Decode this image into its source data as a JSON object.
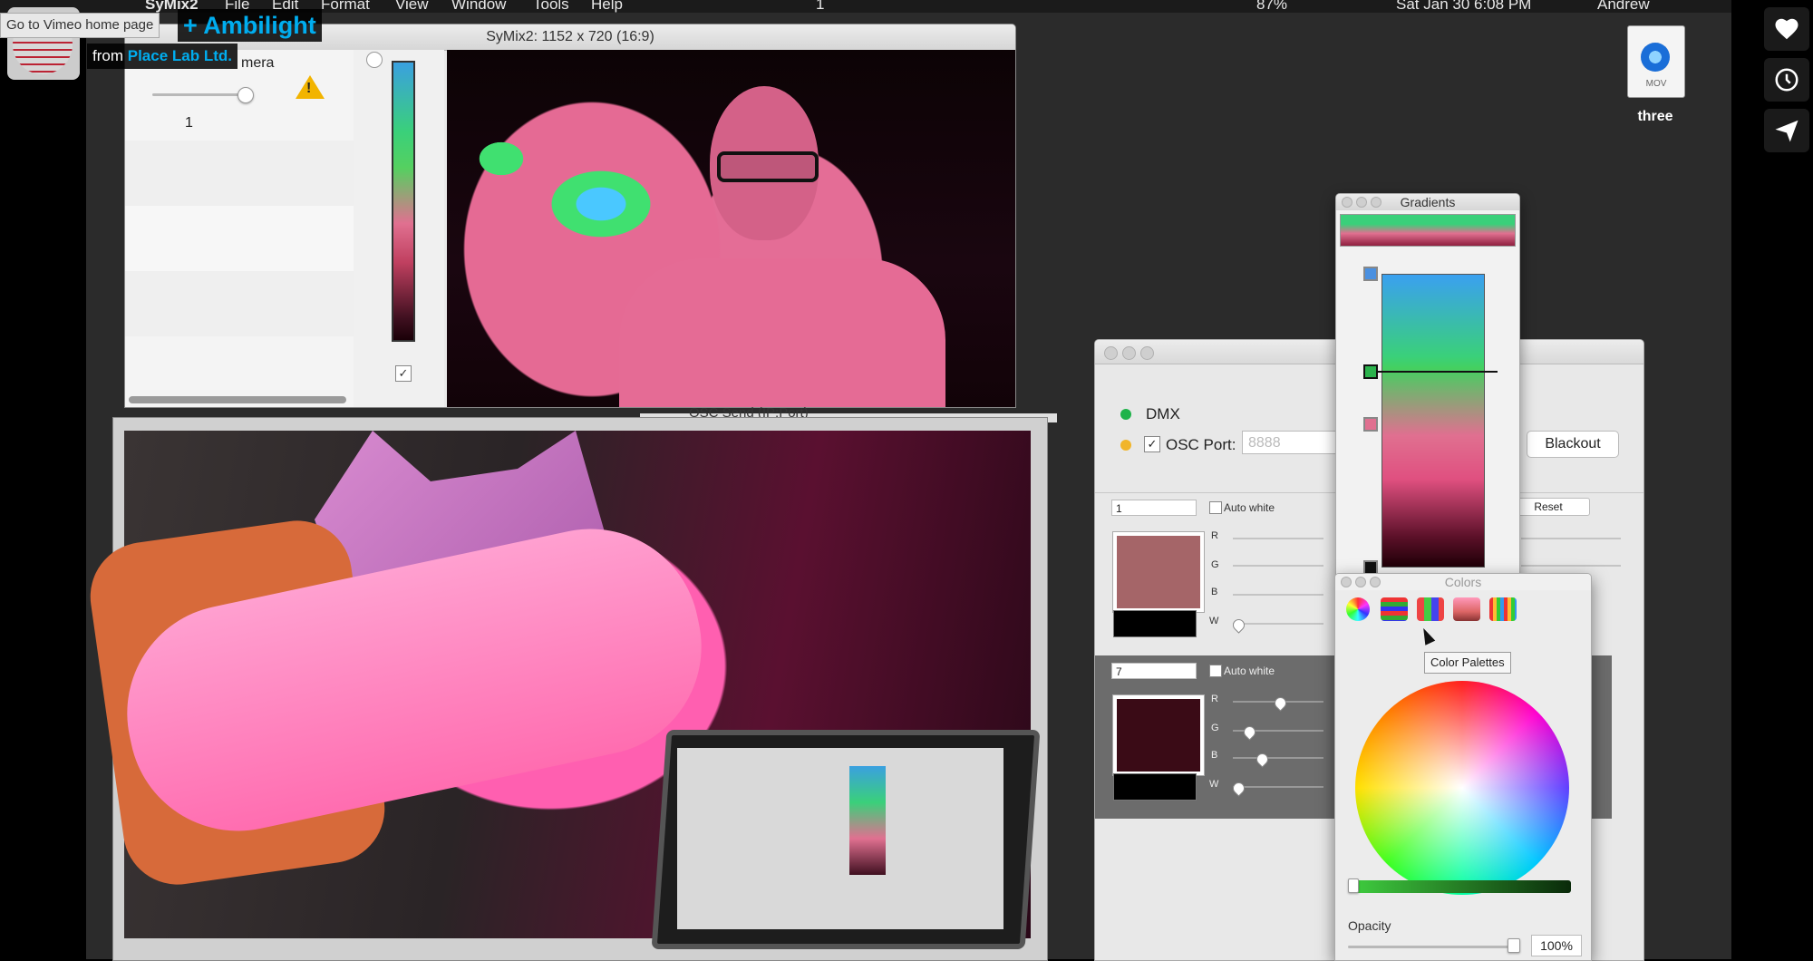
{
  "menubar": {
    "app": "SyMix2",
    "items": [
      "File",
      "Edit",
      "Format",
      "View",
      "Window",
      "Tools",
      "Help"
    ],
    "status": {
      "sync_count": "1",
      "battery": "87%",
      "datetime": "Sat Jan 30  6:08 PM",
      "user": "Andrew"
    }
  },
  "vimeo": {
    "logo_text": "PLACE",
    "home_tooltip": "Go to Vimeo home page",
    "title": "+ Ambilight",
    "from_prefix": "from",
    "from_link": "Place Lab Ltd."
  },
  "rail": {
    "buttons": [
      "heart-icon",
      "clock-icon",
      "send-icon"
    ]
  },
  "desktop_file": {
    "type_label": "MOV",
    "name": "three"
  },
  "symix": {
    "title": "SyMix2: 1152 x 720 (16:9)",
    "camera_label": "mera",
    "slider_value": "1"
  },
  "lower": {
    "osc_send_label": "OSC Send (IP:Port)"
  },
  "dmx": {
    "dmx_label": "DMX",
    "osc_label": "OSC Port:",
    "osc_placeholder": "8888",
    "blackout": "Blackout",
    "reset": "Reset",
    "channels": [
      {
        "number": "1",
        "auto_white": "Auto white",
        "swatch": "#a56568"
      },
      {
        "number": "7",
        "auto_white": "Auto white",
        "swatch": "#3a0b16"
      }
    ],
    "rgbw": [
      "R",
      "G",
      "B",
      "W"
    ],
    "colors": {
      "dmx_dot": "#1fb34a",
      "osc_dot": "#f1b52a"
    }
  },
  "gradients": {
    "title": "Gradients"
  },
  "colors_panel": {
    "title": "Colors",
    "tooltip": "Color Palettes",
    "opacity_label": "Opacity",
    "opacity_value": "100%",
    "tools": [
      "color-wheel-icon",
      "color-sliders-icon",
      "color-palettes-icon",
      "image-palettes-icon",
      "pencils-icon"
    ]
  }
}
